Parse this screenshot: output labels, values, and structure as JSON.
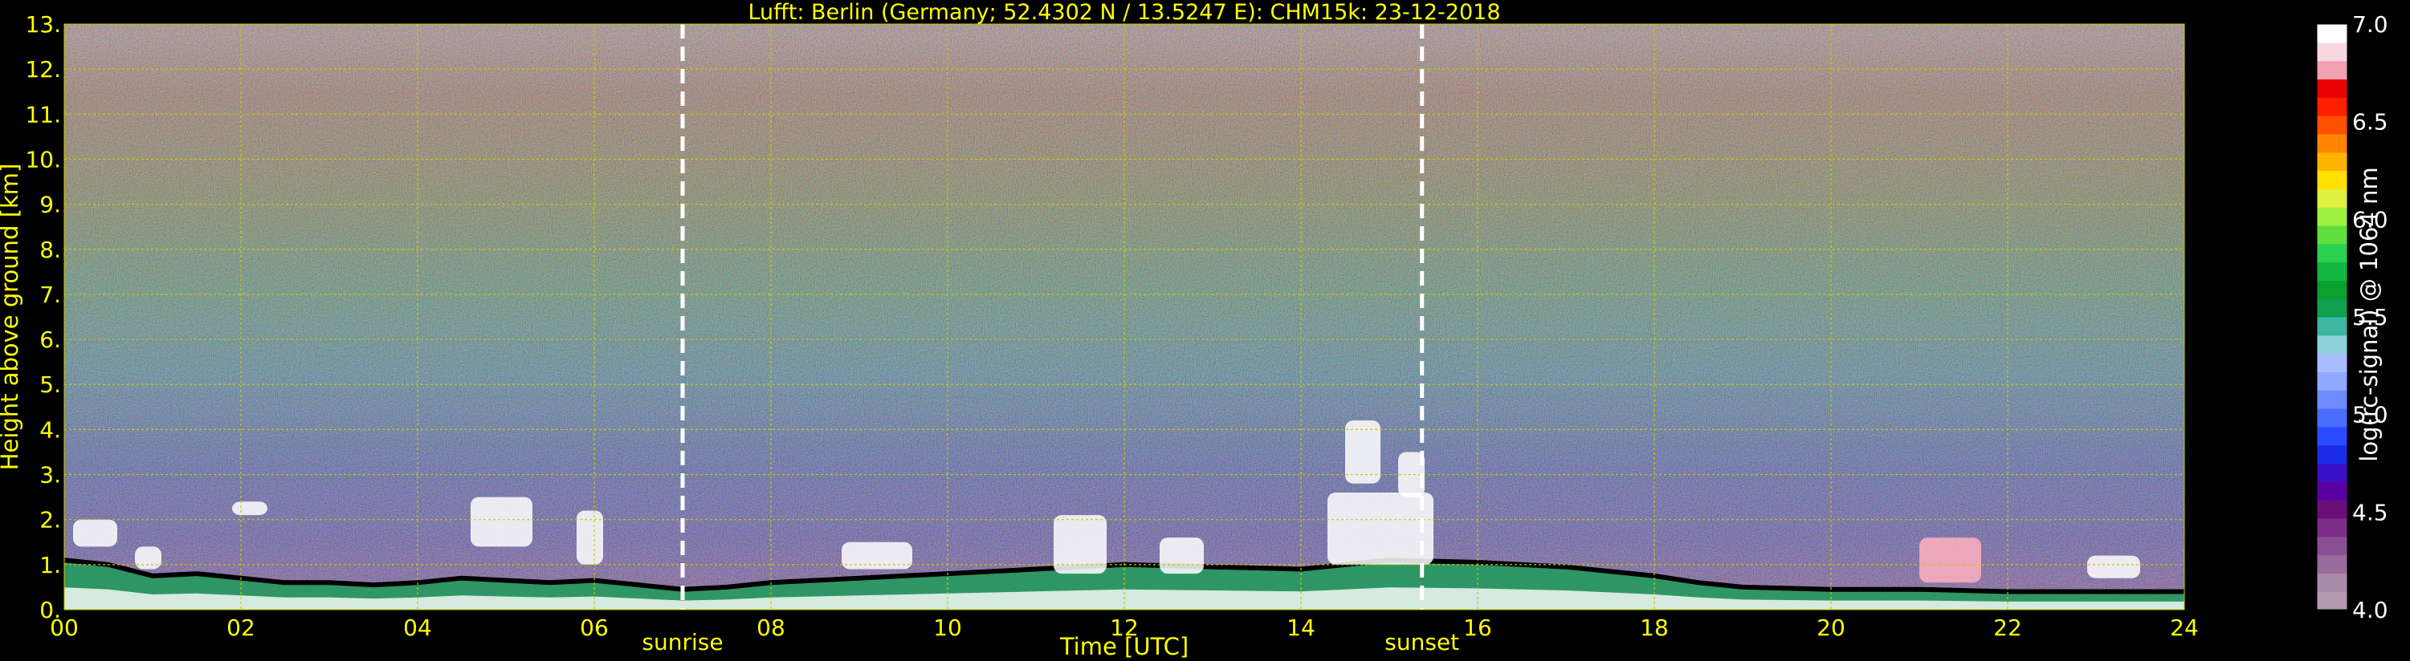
{
  "chart_data": {
    "type": "heatmap",
    "title": "Lufft: Berlin (Germany; 52.4302 N / 13.5247 E):    CHM15k: 23-12-2018",
    "xlabel": "Time [UTC]",
    "ylabel": "Height above ground [km]",
    "xlim": [
      0,
      24
    ],
    "ylim": [
      0,
      13
    ],
    "x_ticks": [
      0,
      2,
      4,
      6,
      8,
      10,
      12,
      14,
      16,
      18,
      20,
      22,
      24
    ],
    "x_tick_labels": [
      "00",
      "02",
      "04",
      "06",
      "08",
      "10",
      "12",
      "14",
      "16",
      "18",
      "20",
      "22",
      "24"
    ],
    "y_ticks": [
      0,
      1,
      2,
      3,
      4,
      5,
      6,
      7,
      8,
      9,
      10,
      11,
      12,
      13
    ],
    "y_tick_labels": [
      "0.",
      "1.",
      "2.",
      "3.",
      "4.",
      "5.",
      "6.",
      "7.",
      "8.",
      "9.",
      "10.",
      "11.",
      "12.",
      "13."
    ],
    "grid": true,
    "markers": [
      {
        "label": "sunrise",
        "x": 7.0
      },
      {
        "label": "sunset",
        "x": 15.37
      }
    ],
    "colorbar": {
      "label": "log(rc-signal) @ 1064 nm",
      "range": [
        4.0,
        7.0
      ],
      "ticks": [
        4.0,
        4.5,
        5.0,
        5.5,
        6.0,
        6.5,
        7.0
      ],
      "tick_labels": [
        "4.0",
        "4.5",
        "5.0",
        "5.5",
        "6.0",
        "6.5",
        "7.0"
      ],
      "colors": [
        "#b49bb0",
        "#a88aa8",
        "#9a6c9e",
        "#8a4e92",
        "#7a2e86",
        "#6a0f7a",
        "#5a00a0",
        "#3a10c8",
        "#1b2ce6",
        "#2a4cff",
        "#4a6cff",
        "#6e8cff",
        "#90a8ff",
        "#a8bcff",
        "#8fd0d8",
        "#3cb8a0",
        "#0fa050",
        "#0ca030",
        "#10b840",
        "#2ad050",
        "#60e040",
        "#a0f040",
        "#e0f040",
        "#ffe000",
        "#ffb400",
        "#ff8400",
        "#ff5000",
        "#ff1e00",
        "#e80000",
        "#f0a0b0",
        "#f8d8e0",
        "#ffffff"
      ]
    },
    "palette": {
      "background": "#000000",
      "text": "#ffff00",
      "grid": "#c8c800",
      "marker_line": "#ffffff"
    },
    "features": {
      "boundary_layer_top_km": [
        [
          0.0,
          1.1
        ],
        [
          0.5,
          1.0
        ],
        [
          1.0,
          0.75
        ],
        [
          1.5,
          0.8
        ],
        [
          2.0,
          0.7
        ],
        [
          2.5,
          0.6
        ],
        [
          3.0,
          0.6
        ],
        [
          3.5,
          0.55
        ],
        [
          4.0,
          0.6
        ],
        [
          4.5,
          0.7
        ],
        [
          5.0,
          0.65
        ],
        [
          5.5,
          0.6
        ],
        [
          6.0,
          0.65
        ],
        [
          6.5,
          0.55
        ],
        [
          7.0,
          0.45
        ],
        [
          7.5,
          0.5
        ],
        [
          8.0,
          0.6
        ],
        [
          9.0,
          0.7
        ],
        [
          10.0,
          0.8
        ],
        [
          11.0,
          0.9
        ],
        [
          12.0,
          1.0
        ],
        [
          13.0,
          0.95
        ],
        [
          14.0,
          0.9
        ],
        [
          15.0,
          1.1
        ],
        [
          16.0,
          1.05
        ],
        [
          17.0,
          0.95
        ],
        [
          18.0,
          0.75
        ],
        [
          18.5,
          0.6
        ],
        [
          19.0,
          0.5
        ],
        [
          20.0,
          0.45
        ],
        [
          21.0,
          0.45
        ],
        [
          22.0,
          0.4
        ],
        [
          23.0,
          0.4
        ],
        [
          24.0,
          0.4
        ]
      ],
      "cloud_blobs": [
        {
          "x": 0.1,
          "y": 1.4,
          "w": 0.5,
          "h": 0.6,
          "color": "#ffffff"
        },
        {
          "x": 0.8,
          "y": 0.9,
          "w": 0.3,
          "h": 0.5,
          "color": "#ffffff"
        },
        {
          "x": 1.9,
          "y": 2.1,
          "w": 0.4,
          "h": 0.3,
          "color": "#ffffff"
        },
        {
          "x": 4.6,
          "y": 1.4,
          "w": 0.7,
          "h": 1.1,
          "color": "#ffffff"
        },
        {
          "x": 5.8,
          "y": 1.0,
          "w": 0.3,
          "h": 1.2,
          "color": "#ffffff"
        },
        {
          "x": 8.8,
          "y": 0.9,
          "w": 0.8,
          "h": 0.6,
          "color": "#ffffff"
        },
        {
          "x": 11.2,
          "y": 0.8,
          "w": 0.6,
          "h": 1.3,
          "color": "#ffffff"
        },
        {
          "x": 12.4,
          "y": 0.8,
          "w": 0.5,
          "h": 0.8,
          "color": "#ffffff"
        },
        {
          "x": 14.5,
          "y": 2.8,
          "w": 0.4,
          "h": 1.4,
          "color": "#ffffff"
        },
        {
          "x": 15.1,
          "y": 2.5,
          "w": 0.3,
          "h": 1.0,
          "color": "#ffffff"
        },
        {
          "x": 14.3,
          "y": 1.0,
          "w": 1.2,
          "h": 1.6,
          "color": "#ffffff"
        },
        {
          "x": 21.0,
          "y": 0.6,
          "w": 0.7,
          "h": 1.0,
          "color": "#ffb0c0"
        },
        {
          "x": 22.9,
          "y": 0.7,
          "w": 0.6,
          "h": 0.5,
          "color": "#ffffff"
        }
      ]
    }
  }
}
